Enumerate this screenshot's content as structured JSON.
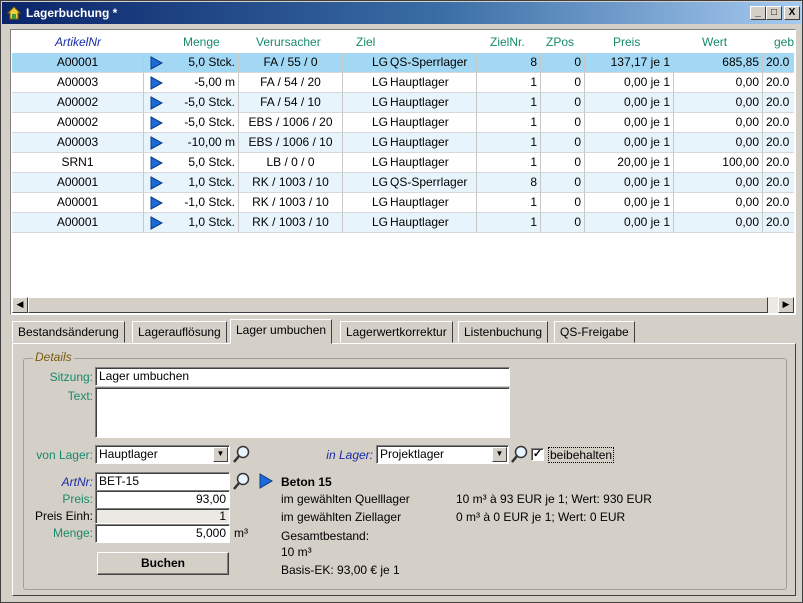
{
  "window": {
    "title": "Lagerbuchung *",
    "controls": {
      "minimize": "_",
      "maximize": "□",
      "close": "X"
    }
  },
  "grid": {
    "columns": [
      "ArtikelNr",
      "Menge",
      "Verursacher",
      "Ziel",
      "ZielNr.",
      "ZPos",
      "Preis",
      "Wert",
      "geb"
    ],
    "rows": [
      {
        "art": "A00001",
        "menge": "5,0 Stck.",
        "verur": "FA / 55 / 0",
        "ziel_code": "LG",
        "ziel_name": "QS-Sperrlager",
        "zielnr": "8",
        "zpos": "0",
        "preis": "137,17 je 1",
        "wert": "685,85",
        "geb": "20.0",
        "selected": true
      },
      {
        "art": "A00003",
        "menge": "-5,00 m",
        "verur": "FA / 54 / 20",
        "ziel_code": "LG",
        "ziel_name": "Hauptlager",
        "zielnr": "1",
        "zpos": "0",
        "preis": "0,00 je 1",
        "wert": "0,00",
        "geb": "20.0",
        "selected": false
      },
      {
        "art": "A00002",
        "menge": "-5,0 Stck.",
        "verur": "FA / 54 / 10",
        "ziel_code": "LG",
        "ziel_name": "Hauptlager",
        "zielnr": "1",
        "zpos": "0",
        "preis": "0,00 je 1",
        "wert": "0,00",
        "geb": "20.0",
        "selected": false
      },
      {
        "art": "A00002",
        "menge": "-5,0 Stck.",
        "verur": "EBS / 1006 / 20",
        "ziel_code": "LG",
        "ziel_name": "Hauptlager",
        "zielnr": "1",
        "zpos": "0",
        "preis": "0,00 je 1",
        "wert": "0,00",
        "geb": "20.0",
        "selected": false
      },
      {
        "art": "A00003",
        "menge": "-10,00 m",
        "verur": "EBS / 1006 / 10",
        "ziel_code": "LG",
        "ziel_name": "Hauptlager",
        "zielnr": "1",
        "zpos": "0",
        "preis": "0,00 je 1",
        "wert": "0,00",
        "geb": "20.0",
        "selected": false
      },
      {
        "art": "SRN1",
        "menge": "5,0 Stck.",
        "verur": "LB / 0 / 0",
        "ziel_code": "LG",
        "ziel_name": "Hauptlager",
        "zielnr": "1",
        "zpos": "0",
        "preis": "20,00 je 1",
        "wert": "100,00",
        "geb": "20.0",
        "selected": false
      },
      {
        "art": "A00001",
        "menge": "1,0 Stck.",
        "verur": "RK / 1003 / 10",
        "ziel_code": "LG",
        "ziel_name": "QS-Sperrlager",
        "zielnr": "8",
        "zpos": "0",
        "preis": "0,00 je 1",
        "wert": "0,00",
        "geb": "20.0",
        "selected": false
      },
      {
        "art": "A00001",
        "menge": "-1,0 Stck.",
        "verur": "RK / 1003 / 10",
        "ziel_code": "LG",
        "ziel_name": "Hauptlager",
        "zielnr": "1",
        "zpos": "0",
        "preis": "0,00 je 1",
        "wert": "0,00",
        "geb": "20.0",
        "selected": false
      },
      {
        "art": "A00001",
        "menge": "1,0 Stck.",
        "verur": "RK / 1003 / 10",
        "ziel_code": "LG",
        "ziel_name": "Hauptlager",
        "zielnr": "1",
        "zpos": "0",
        "preis": "0,00 je 1",
        "wert": "0,00",
        "geb": "20.0",
        "selected": false
      }
    ]
  },
  "tabs": [
    "Bestandsänderung",
    "Lagerauflösung",
    "Lager umbuchen",
    "Lagerwertkorrektur",
    "Listenbuchung",
    "QS-Freigabe"
  ],
  "active_tab": "Lager umbuchen",
  "details": {
    "legend": "Details",
    "sitzung_label": "Sitzung:",
    "sitzung_value": "Lager umbuchen",
    "text_label": "Text:",
    "text_value": "",
    "von_lager_label": "von Lager:",
    "von_lager_value": "Hauptlager",
    "in_lager_label": "in Lager:",
    "in_lager_value": "Projektlager",
    "beibehalten_label": "beibehalten",
    "beibehalten_checked": true,
    "artnr_label": "ArtNr:",
    "artnr_value": "BET-15",
    "preis_label": "Preis:",
    "preis_value": "93,00",
    "preis_einh_label": "Preis Einh:",
    "preis_einh_value": "1",
    "menge_label": "Menge:",
    "menge_value": "5,000",
    "menge_unit": "m³",
    "buchen_label": "Buchen"
  },
  "article_info": {
    "name": "Beton 15",
    "quelllager_label": "im gewählten Quelllager",
    "quelllager_value": "10 m³ à 93 EUR je 1;  Wert: 930 EUR",
    "ziellager_label": "im gewählten Ziellager",
    "ziellager_value": "0 m³ à 0 EUR je 1;  Wert: 0 EUR",
    "gesamtbestand_label": "Gesamtbestand:",
    "gesamtbestand_value": "10 m³",
    "basis_ek": "Basis-EK: 93,00 € je 1"
  },
  "colors": {
    "selected_row": "#a3d8f5",
    "alt_row": "#e8f4fc",
    "header_text": "#188a6a",
    "accent_blue": "#1a2aa8",
    "title_bar": "#0a246a"
  }
}
